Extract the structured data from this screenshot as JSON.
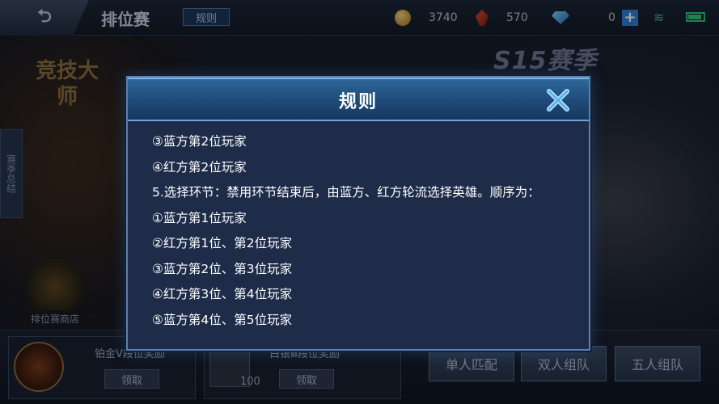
{
  "topbar": {
    "back_icon": "back-arrow-icon",
    "title": "排位赛",
    "rules_tab": "规则",
    "gold": "3740",
    "tickets": "570",
    "diamonds": "0"
  },
  "background": {
    "season_badge": "S15赛季",
    "master_label": "竞技大师",
    "side_tab": "赛季总结",
    "shop_label": "排位赛商店",
    "rewards": [
      {
        "title": "铂金Ⅴ段位奖励",
        "claim": "领取"
      },
      {
        "title": "白银Ⅲ段位奖励",
        "count": "100",
        "claim": "领取"
      }
    ],
    "modes": [
      "单人匹配",
      "双人组队",
      "五人组队"
    ]
  },
  "modal": {
    "title": "规则",
    "close_icon": "close-x-icon",
    "lines": [
      "③蓝方第2位玩家",
      "④红方第2位玩家",
      "5.选择环节：禁用环节结束后，由蓝方、红方轮流选择英雄。顺序为：",
      "①蓝方第1位玩家",
      "②红方第1位、第2位玩家",
      "③蓝方第2位、第3位玩家",
      "④红方第3位、第4位玩家",
      "⑤蓝方第4位、第5位玩家"
    ]
  },
  "colors": {
    "modal_bg": "#1e2c4a",
    "header_bg": "#1f4a78",
    "close_x": "#8fd0ff"
  }
}
